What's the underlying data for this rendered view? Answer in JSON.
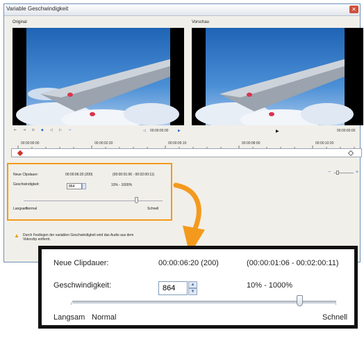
{
  "window": {
    "title": "Variable Geschwindigkeit",
    "close_glyph": "✕"
  },
  "panels": {
    "original_label": "Original",
    "preview_label": "Vorschau"
  },
  "original_controls": {
    "timecode": "00:00:00:00"
  },
  "preview_controls": {
    "timecode": "00:00:00:00"
  },
  "timeline": {
    "ticks": [
      "00:00:00:00",
      "00:00:02:20",
      "00:00:05:10",
      "00:00:08:00",
      "00:00:10:20"
    ]
  },
  "settings_small": {
    "duration_label": "Neue Clipdauer:",
    "duration_value": "00:00:06:20 (200)",
    "duration_range": "(00:00:01:06 - 00:02:00:11)",
    "speed_label": "Geschwindigkeit:",
    "speed_value": "864",
    "speed_range": "10% - 1000%",
    "slow_label": "Langsam",
    "normal_label": "Normal",
    "fast_label": "Schnell"
  },
  "warning": {
    "text_line1": "Durch Festlegen der variablen Geschwindigkeit wird das Audio aus dem",
    "text_line2": "Videoclip entfernt."
  },
  "zoom": {
    "duration_label": "Neue Clipdauer:",
    "duration_value": "00:00:06:20 (200)",
    "duration_range": "(00:00:01:06 - 00:02:00:11)",
    "speed_label": "Geschwindigkeit:",
    "speed_value": "864",
    "speed_range": "10% - 1000%",
    "slow_label": "Langsam",
    "normal_label": "Normal",
    "fast_label": "Schnell",
    "slider_level_fraction": 0.86
  },
  "colors": {
    "callout_orange": "#f39a1e",
    "window_border": "#6d8fb8",
    "playhead_red": "#d0332a"
  }
}
